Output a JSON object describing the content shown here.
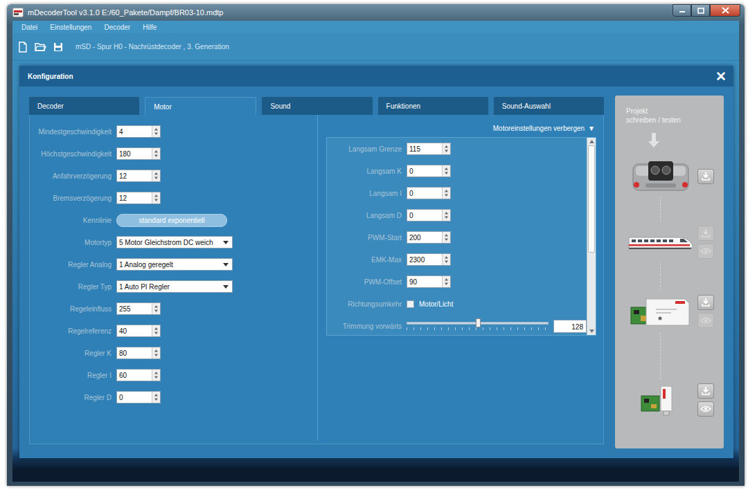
{
  "window": {
    "title": "mDecoderTool v3.1.0 E:/60_Pakete/Dampf/BR03-10.mdtp"
  },
  "menu": [
    "Datei",
    "Einstellungen",
    "Decoder",
    "Hilfe"
  ],
  "toolbar": {
    "project": "mSD - Spur H0 - Nachrüstdecoder , 3. Generation"
  },
  "dialog": {
    "title": "Konfiguration",
    "close": "✕"
  },
  "tabs": [
    {
      "label": "Decoder",
      "selected": false
    },
    {
      "label": "Motor",
      "selected": true
    },
    {
      "label": "Sound",
      "selected": false
    },
    {
      "label": "Funktionen",
      "selected": false
    },
    {
      "label": "Sound-Auswahl",
      "selected": false
    }
  ],
  "left_fields": [
    {
      "kind": "spin",
      "label": "Mindestgeschwindigkeit",
      "value": "4"
    },
    {
      "kind": "spin",
      "label": "Höchstgeschwindigkeit",
      "value": "180"
    },
    {
      "kind": "spin",
      "label": "Anfahrverzögerung",
      "value": "12"
    },
    {
      "kind": "spin",
      "label": "Bremsverzögerung",
      "value": "12"
    },
    {
      "kind": "button",
      "label": "Kennlinie",
      "value": "standard exponentiell"
    },
    {
      "kind": "select",
      "label": "Motortyp",
      "value": "5 Motor Gleichstrom DC weich"
    },
    {
      "kind": "select",
      "label": "Regler Analog",
      "value": "1 Analog geregelt"
    },
    {
      "kind": "select",
      "label": "Regler Typ",
      "value": "1 Auto PI Regler"
    },
    {
      "kind": "spin",
      "label": "Regeleinfluss",
      "value": "255"
    },
    {
      "kind": "spin",
      "label": "Regelreferenz",
      "value": "40"
    },
    {
      "kind": "spin",
      "label": "Regler K",
      "value": "80"
    },
    {
      "kind": "spin",
      "label": "Regler I",
      "value": "60"
    },
    {
      "kind": "spin",
      "label": "Regler D",
      "value": "0"
    }
  ],
  "motor_settings": {
    "toggle": "Motoreinstellungen verbergen",
    "toggle_icon": "▼",
    "expanded": true,
    "scroll": 0,
    "fields": [
      {
        "kind": "spin",
        "label": "Langsam Grenze",
        "value": "115"
      },
      {
        "kind": "spin",
        "label": "Langsam K",
        "value": "0"
      },
      {
        "kind": "spin",
        "label": "Langsam I",
        "value": "0"
      },
      {
        "kind": "spin",
        "label": "Langsam D",
        "value": "0"
      },
      {
        "kind": "spin",
        "label": "PWM-Start",
        "value": "200"
      },
      {
        "kind": "spin",
        "label": "EMK-Max",
        "value": "2300"
      },
      {
        "kind": "spin",
        "label": "PWM-Offset",
        "value": "90"
      },
      {
        "kind": "checkbox",
        "label": "Richtungsumkehr",
        "value": "Motor/Licht",
        "checked": false
      },
      {
        "kind": "slider",
        "label": "Trimmung vorwärts",
        "value": "128",
        "level": 0.5
      }
    ]
  },
  "side_panel": {
    "title_lines": [
      "Projekt",
      "schreiben / testen"
    ],
    "devices": [
      {
        "kind": "decoder",
        "buttons": [
          {
            "kind": "write",
            "disabled": false
          }
        ]
      },
      {
        "kind": "train",
        "buttons": [
          {
            "kind": "write",
            "disabled": true
          },
          {
            "kind": "test",
            "disabled": true
          }
        ]
      },
      {
        "kind": "programmer",
        "buttons": [
          {
            "kind": "write",
            "disabled": false
          },
          {
            "kind": "test",
            "disabled": true
          }
        ]
      },
      {
        "kind": "stick",
        "buttons": [
          {
            "kind": "write",
            "disabled": false
          },
          {
            "kind": "test",
            "disabled": false
          }
        ]
      }
    ]
  }
}
